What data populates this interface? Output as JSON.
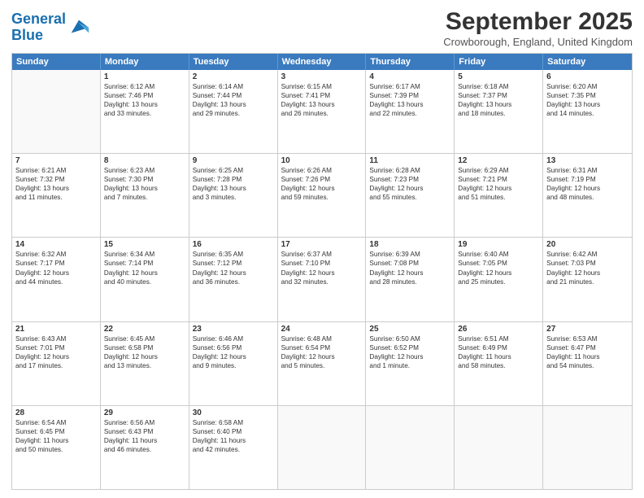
{
  "logo": {
    "line1": "General",
    "line2": "Blue"
  },
  "title": "September 2025",
  "location": "Crowborough, England, United Kingdom",
  "header_days": [
    "Sunday",
    "Monday",
    "Tuesday",
    "Wednesday",
    "Thursday",
    "Friday",
    "Saturday"
  ],
  "rows": [
    [
      {
        "day": "",
        "lines": []
      },
      {
        "day": "1",
        "lines": [
          "Sunrise: 6:12 AM",
          "Sunset: 7:46 PM",
          "Daylight: 13 hours",
          "and 33 minutes."
        ]
      },
      {
        "day": "2",
        "lines": [
          "Sunrise: 6:14 AM",
          "Sunset: 7:44 PM",
          "Daylight: 13 hours",
          "and 29 minutes."
        ]
      },
      {
        "day": "3",
        "lines": [
          "Sunrise: 6:15 AM",
          "Sunset: 7:41 PM",
          "Daylight: 13 hours",
          "and 26 minutes."
        ]
      },
      {
        "day": "4",
        "lines": [
          "Sunrise: 6:17 AM",
          "Sunset: 7:39 PM",
          "Daylight: 13 hours",
          "and 22 minutes."
        ]
      },
      {
        "day": "5",
        "lines": [
          "Sunrise: 6:18 AM",
          "Sunset: 7:37 PM",
          "Daylight: 13 hours",
          "and 18 minutes."
        ]
      },
      {
        "day": "6",
        "lines": [
          "Sunrise: 6:20 AM",
          "Sunset: 7:35 PM",
          "Daylight: 13 hours",
          "and 14 minutes."
        ]
      }
    ],
    [
      {
        "day": "7",
        "lines": [
          "Sunrise: 6:21 AM",
          "Sunset: 7:32 PM",
          "Daylight: 13 hours",
          "and 11 minutes."
        ]
      },
      {
        "day": "8",
        "lines": [
          "Sunrise: 6:23 AM",
          "Sunset: 7:30 PM",
          "Daylight: 13 hours",
          "and 7 minutes."
        ]
      },
      {
        "day": "9",
        "lines": [
          "Sunrise: 6:25 AM",
          "Sunset: 7:28 PM",
          "Daylight: 13 hours",
          "and 3 minutes."
        ]
      },
      {
        "day": "10",
        "lines": [
          "Sunrise: 6:26 AM",
          "Sunset: 7:26 PM",
          "Daylight: 12 hours",
          "and 59 minutes."
        ]
      },
      {
        "day": "11",
        "lines": [
          "Sunrise: 6:28 AM",
          "Sunset: 7:23 PM",
          "Daylight: 12 hours",
          "and 55 minutes."
        ]
      },
      {
        "day": "12",
        "lines": [
          "Sunrise: 6:29 AM",
          "Sunset: 7:21 PM",
          "Daylight: 12 hours",
          "and 51 minutes."
        ]
      },
      {
        "day": "13",
        "lines": [
          "Sunrise: 6:31 AM",
          "Sunset: 7:19 PM",
          "Daylight: 12 hours",
          "and 48 minutes."
        ]
      }
    ],
    [
      {
        "day": "14",
        "lines": [
          "Sunrise: 6:32 AM",
          "Sunset: 7:17 PM",
          "Daylight: 12 hours",
          "and 44 minutes."
        ]
      },
      {
        "day": "15",
        "lines": [
          "Sunrise: 6:34 AM",
          "Sunset: 7:14 PM",
          "Daylight: 12 hours",
          "and 40 minutes."
        ]
      },
      {
        "day": "16",
        "lines": [
          "Sunrise: 6:35 AM",
          "Sunset: 7:12 PM",
          "Daylight: 12 hours",
          "and 36 minutes."
        ]
      },
      {
        "day": "17",
        "lines": [
          "Sunrise: 6:37 AM",
          "Sunset: 7:10 PM",
          "Daylight: 12 hours",
          "and 32 minutes."
        ]
      },
      {
        "day": "18",
        "lines": [
          "Sunrise: 6:39 AM",
          "Sunset: 7:08 PM",
          "Daylight: 12 hours",
          "and 28 minutes."
        ]
      },
      {
        "day": "19",
        "lines": [
          "Sunrise: 6:40 AM",
          "Sunset: 7:05 PM",
          "Daylight: 12 hours",
          "and 25 minutes."
        ]
      },
      {
        "day": "20",
        "lines": [
          "Sunrise: 6:42 AM",
          "Sunset: 7:03 PM",
          "Daylight: 12 hours",
          "and 21 minutes."
        ]
      }
    ],
    [
      {
        "day": "21",
        "lines": [
          "Sunrise: 6:43 AM",
          "Sunset: 7:01 PM",
          "Daylight: 12 hours",
          "and 17 minutes."
        ]
      },
      {
        "day": "22",
        "lines": [
          "Sunrise: 6:45 AM",
          "Sunset: 6:58 PM",
          "Daylight: 12 hours",
          "and 13 minutes."
        ]
      },
      {
        "day": "23",
        "lines": [
          "Sunrise: 6:46 AM",
          "Sunset: 6:56 PM",
          "Daylight: 12 hours",
          "and 9 minutes."
        ]
      },
      {
        "day": "24",
        "lines": [
          "Sunrise: 6:48 AM",
          "Sunset: 6:54 PM",
          "Daylight: 12 hours",
          "and 5 minutes."
        ]
      },
      {
        "day": "25",
        "lines": [
          "Sunrise: 6:50 AM",
          "Sunset: 6:52 PM",
          "Daylight: 12 hours",
          "and 1 minute."
        ]
      },
      {
        "day": "26",
        "lines": [
          "Sunrise: 6:51 AM",
          "Sunset: 6:49 PM",
          "Daylight: 11 hours",
          "and 58 minutes."
        ]
      },
      {
        "day": "27",
        "lines": [
          "Sunrise: 6:53 AM",
          "Sunset: 6:47 PM",
          "Daylight: 11 hours",
          "and 54 minutes."
        ]
      }
    ],
    [
      {
        "day": "28",
        "lines": [
          "Sunrise: 6:54 AM",
          "Sunset: 6:45 PM",
          "Daylight: 11 hours",
          "and 50 minutes."
        ]
      },
      {
        "day": "29",
        "lines": [
          "Sunrise: 6:56 AM",
          "Sunset: 6:43 PM",
          "Daylight: 11 hours",
          "and 46 minutes."
        ]
      },
      {
        "day": "30",
        "lines": [
          "Sunrise: 6:58 AM",
          "Sunset: 6:40 PM",
          "Daylight: 11 hours",
          "and 42 minutes."
        ]
      },
      {
        "day": "",
        "lines": []
      },
      {
        "day": "",
        "lines": []
      },
      {
        "day": "",
        "lines": []
      },
      {
        "day": "",
        "lines": []
      }
    ]
  ]
}
